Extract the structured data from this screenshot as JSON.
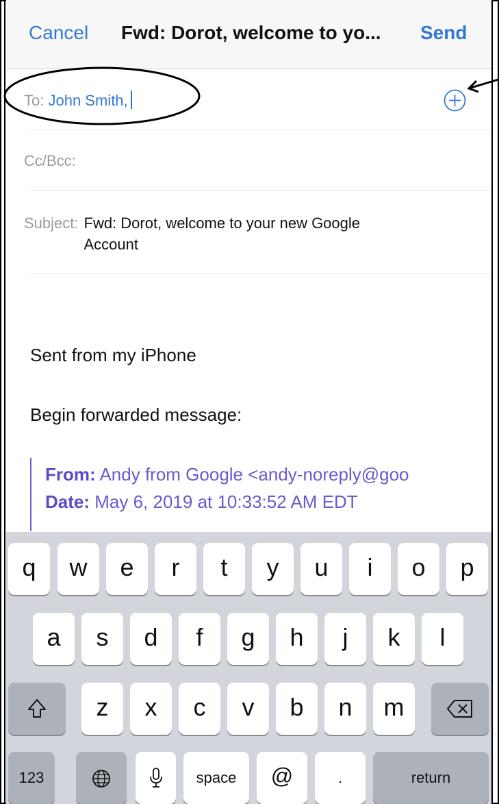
{
  "nav": {
    "cancel": "Cancel",
    "title": "Fwd: Dorot, welcome to yo...",
    "send": "Send"
  },
  "compose": {
    "to_label": "To:",
    "to_value": "John Smith,",
    "cc_label": "Cc/Bcc:",
    "subject_label": "Subject:",
    "subject_value": "Fwd: Dorot, welcome to your new Google Account"
  },
  "body": {
    "sent_from": "Sent from my iPhone",
    "begin_forwarded": "Begin forwarded message:",
    "from_label": "From:",
    "from_value": "Andy from Google <andy-noreply@goo",
    "date_label": "Date:",
    "date_value": "May 6, 2019 at 10:33:52 AM EDT"
  },
  "keyboard": {
    "row1": [
      "q",
      "w",
      "e",
      "r",
      "t",
      "y",
      "u",
      "i",
      "o",
      "p"
    ],
    "row2": [
      "a",
      "s",
      "d",
      "f",
      "g",
      "h",
      "j",
      "k",
      "l"
    ],
    "row3": [
      "z",
      "x",
      "c",
      "v",
      "b",
      "n",
      "m"
    ],
    "numbers": "123",
    "space": "space",
    "at": "@",
    "period": ".",
    "return": "return"
  },
  "colors": {
    "accent": "#3478d4",
    "quote": "#6a5acd",
    "keyboard_bg": "#d2d5db"
  },
  "icons": [
    "add-contact-icon",
    "shift-icon",
    "backspace-icon",
    "globe-icon",
    "microphone-icon"
  ]
}
